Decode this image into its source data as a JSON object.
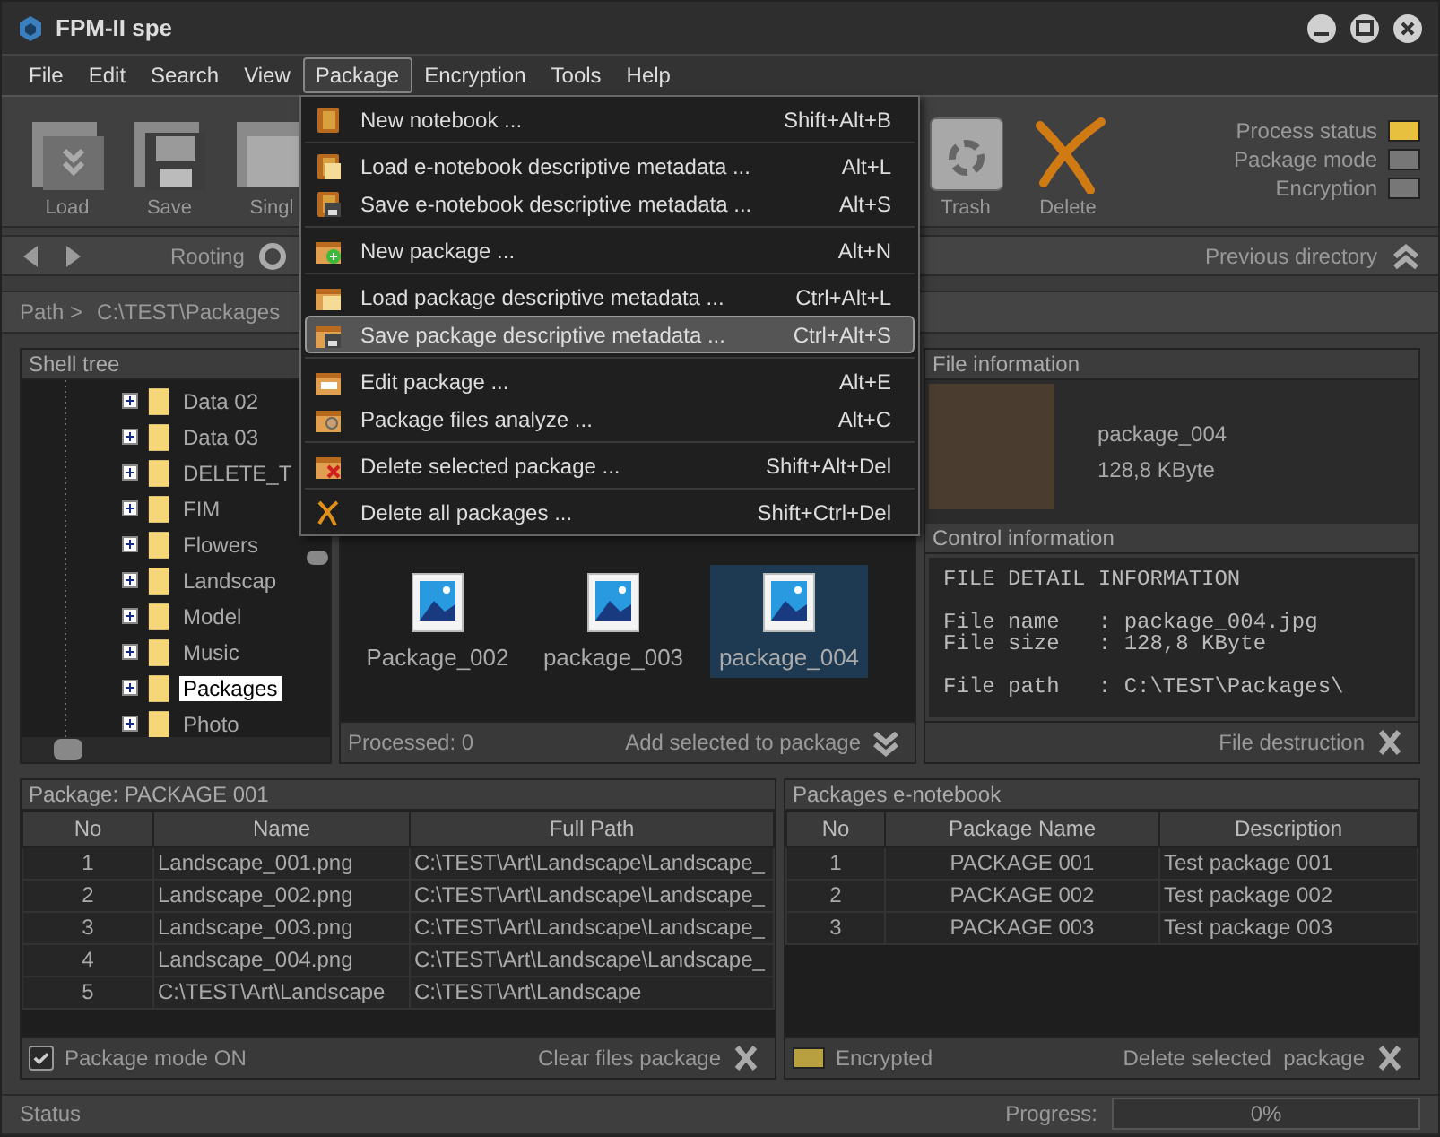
{
  "window": {
    "title": "FPM-II spe"
  },
  "menu_bar": [
    {
      "label": "File",
      "selected": false
    },
    {
      "label": "Edit",
      "selected": false
    },
    {
      "label": "Search",
      "selected": false
    },
    {
      "label": "View",
      "selected": false
    },
    {
      "label": "Package",
      "selected": true
    },
    {
      "label": "Encryption",
      "selected": false
    },
    {
      "label": "Tools",
      "selected": false
    },
    {
      "label": "Help",
      "selected": false
    }
  ],
  "toolbar": {
    "buttons": [
      {
        "label": "Load",
        "kind": "load"
      },
      {
        "label": "Save",
        "kind": "save"
      },
      {
        "label": "Singl",
        "kind": "single"
      },
      {
        "label": "Trash",
        "kind": "trash"
      },
      {
        "label": "Delete",
        "kind": "delete"
      }
    ],
    "indicators": [
      {
        "label": "Process status",
        "on": true
      },
      {
        "label": "Package mode",
        "on": false
      },
      {
        "label": "Encryption",
        "on": false
      }
    ]
  },
  "nav": {
    "rooting": "Rooting",
    "previous": "Previous directory"
  },
  "path": {
    "label": "Path >",
    "value": "C:\\TEST\\Packages"
  },
  "shell_tree": {
    "title": "Shell tree",
    "items": [
      {
        "label": "Data 02",
        "selected": false
      },
      {
        "label": "Data 03",
        "selected": false
      },
      {
        "label": "DELETE_T",
        "selected": false
      },
      {
        "label": "FIM",
        "selected": false
      },
      {
        "label": "Flowers",
        "selected": false
      },
      {
        "label": "Landscap",
        "selected": false
      },
      {
        "label": "Model",
        "selected": false
      },
      {
        "label": "Music",
        "selected": false
      },
      {
        "label": "Packages",
        "selected": true
      },
      {
        "label": "Photo",
        "selected": false
      }
    ]
  },
  "files": {
    "items": [
      {
        "name": "Package_002",
        "selected": false
      },
      {
        "name": "package_003",
        "selected": false
      },
      {
        "name": "package_004",
        "selected": true
      }
    ],
    "processed": "Processed: 0",
    "add": "Add selected to package"
  },
  "file_info": {
    "title": "File information",
    "name": "package_004",
    "size": "128,8 KByte"
  },
  "control_info": {
    "title": "Control information",
    "text": "FILE DETAIL INFORMATION\n\nFile name   : package_004.jpg\nFile size   : 128,8 KByte\n\nFile path   : C:\\TEST\\Packages\\",
    "destruction": "File destruction"
  },
  "package_table": {
    "title": "Package: PACKAGE 001",
    "columns": [
      "No",
      "Name",
      "Full Path"
    ],
    "rows": [
      [
        "1",
        "Landscape_001.png",
        "C:\\TEST\\Art\\Landscape\\Landscape_"
      ],
      [
        "2",
        "Landscape_002.png",
        "C:\\TEST\\Art\\Landscape\\Landscape_"
      ],
      [
        "3",
        "Landscape_003.png",
        "C:\\TEST\\Art\\Landscape\\Landscape_"
      ],
      [
        "4",
        "Landscape_004.png",
        "C:\\TEST\\Art\\Landscape\\Landscape_"
      ],
      [
        "5",
        "C:\\TEST\\Art\\Landscape",
        "C:\\TEST\\Art\\Landscape"
      ]
    ],
    "mode": {
      "label": "Package mode ON",
      "checked": true
    },
    "clear": "Clear files package"
  },
  "notebook_table": {
    "title": "Packages e-notebook",
    "columns": [
      "No",
      "Package Name",
      "Description"
    ],
    "rows": [
      [
        "1",
        "PACKAGE 001",
        "Test package 001"
      ],
      [
        "2",
        "PACKAGE 002",
        "Test package 002"
      ],
      [
        "3",
        "PACKAGE 003",
        "Test package 003"
      ]
    ],
    "encrypted": {
      "label": "Encrypted",
      "on": true
    },
    "delete": "Delete selected  package"
  },
  "status_bar": {
    "status": "Status",
    "progress_label": "Progress:",
    "progress": "0%",
    "level": 0
  },
  "package_menu": {
    "groups": [
      [
        {
          "label": "New notebook ...",
          "shortcut": "Shift+Alt+B",
          "kind": "notebook",
          "selected": false
        }
      ],
      [
        {
          "label": "Load e-notebook descriptive metadata ...",
          "shortcut": "Alt+L",
          "kind": "notebook-load",
          "selected": false
        },
        {
          "label": "Save e-notebook descriptive metadata ...",
          "shortcut": "Alt+S",
          "kind": "notebook-save",
          "selected": false
        }
      ],
      [
        {
          "label": "New package ...",
          "shortcut": "Alt+N",
          "kind": "box-new",
          "selected": false
        }
      ],
      [
        {
          "label": "Load package descriptive metadata ...",
          "shortcut": "Ctrl+Alt+L",
          "kind": "box-load",
          "selected": false
        },
        {
          "label": "Save package descriptive metadata ...",
          "shortcut": "Ctrl+Alt+S",
          "kind": "box-save",
          "selected": true
        }
      ],
      [
        {
          "label": "Edit package ...",
          "shortcut": "Alt+E",
          "kind": "box-edit",
          "selected": false
        },
        {
          "label": "Package files analyze ...",
          "shortcut": "Alt+C",
          "kind": "box-analyze",
          "selected": false
        }
      ],
      [
        {
          "label": "Delete selected package ...",
          "shortcut": "Shift+Alt+Del",
          "kind": "box-delete",
          "selected": false
        }
      ],
      [
        {
          "label": "Delete all packages ...",
          "shortcut": "Shift+Ctrl+Del",
          "kind": "cross",
          "selected": false
        }
      ]
    ]
  }
}
